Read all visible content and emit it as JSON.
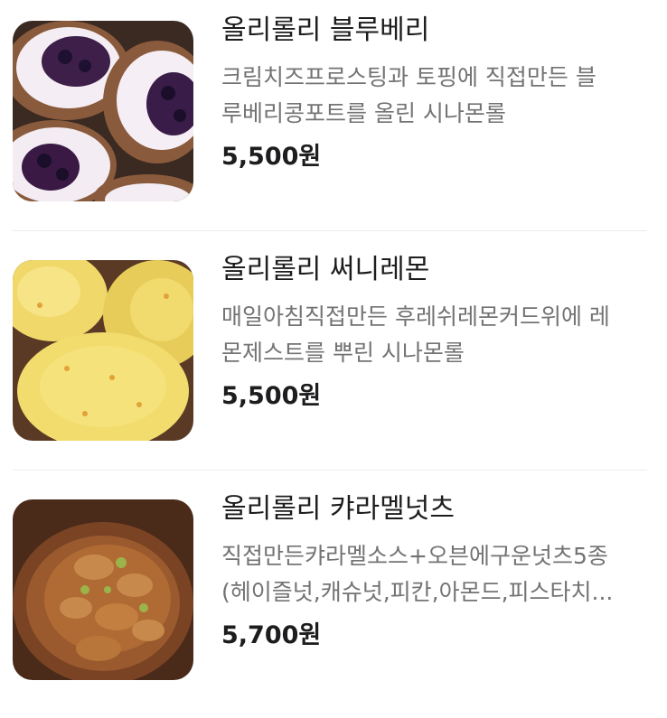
{
  "items": [
    {
      "name": "올리롤리 블루베리",
      "desc_lines": [
        "크림치즈프로스팅과 토핑에 직접만든 블",
        "루베리콩포트를 올린 시나몬롤"
      ],
      "price": "5,500원",
      "image": "blueberry-cinnamon-roll-photo"
    },
    {
      "name": "올리롤리 써니레몬",
      "desc_lines": [
        "매일아침직접만든 후레쉬레몬커드위에 레",
        "몬제스트를 뿌린 시나몬롤"
      ],
      "price": "5,500원",
      "image": "lemon-cinnamon-roll-photo"
    },
    {
      "name": "올리롤리 캬라멜넛츠",
      "desc_lines": [
        "직접만든캬라멜소스+오븐에구운넛츠5종",
        "(헤이즐넛,캐슈넛,피칸,아몬드,피스타치..."
      ],
      "price": "5,700원",
      "image": "caramel-nuts-cinnamon-roll-photo"
    }
  ]
}
